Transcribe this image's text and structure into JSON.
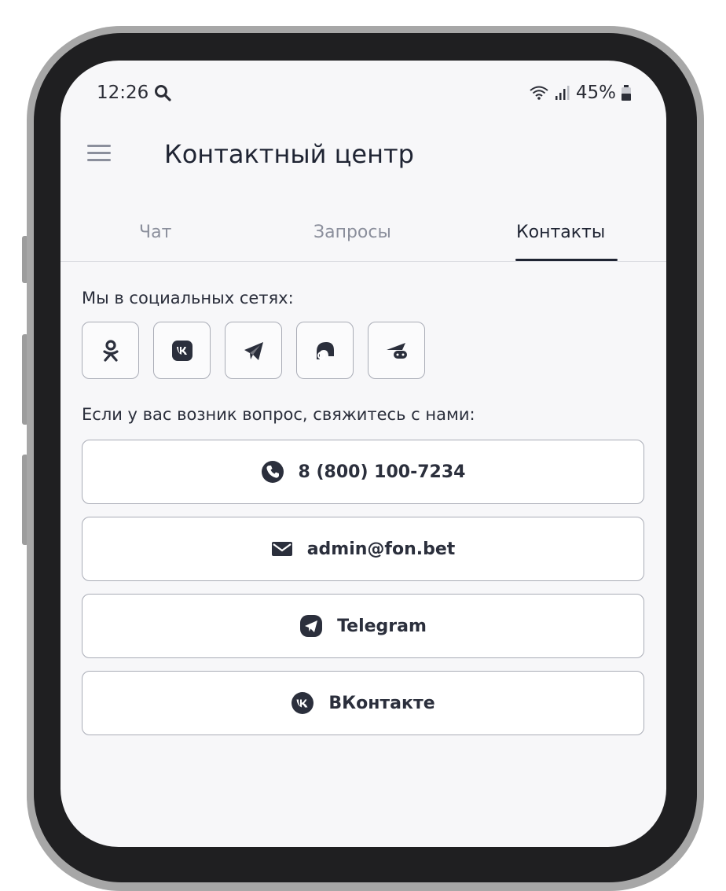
{
  "status_bar": {
    "time": "12:26",
    "battery": "45%"
  },
  "header": {
    "title": "Контактный центр"
  },
  "tabs": [
    {
      "label": "Чат",
      "active": false
    },
    {
      "label": "Запросы",
      "active": false
    },
    {
      "label": "Контакты",
      "active": true
    }
  ],
  "social": {
    "label": "Мы в социальных сетях:",
    "icons": [
      "odnoklassniki-icon",
      "vk-icon",
      "telegram-icon",
      "messenger-icon",
      "games-icon"
    ]
  },
  "contact": {
    "label": "Если у вас возник вопрос, свяжитесь с нами:",
    "buttons": [
      {
        "label": "8 (800) 100-7234",
        "icon": "phone-icon"
      },
      {
        "label": "admin@fon.bet",
        "icon": "mail-icon"
      },
      {
        "label": "Telegram",
        "icon": "telegram-icon"
      },
      {
        "label": "ВКонтакте",
        "icon": "vk-icon"
      }
    ]
  },
  "colors": {
    "text_dark": "#1f2433",
    "text_muted": "#8b8f9c",
    "border": "#a9acb6",
    "screen_bg": "#f7f7f9",
    "frame": "#1f1f21"
  }
}
